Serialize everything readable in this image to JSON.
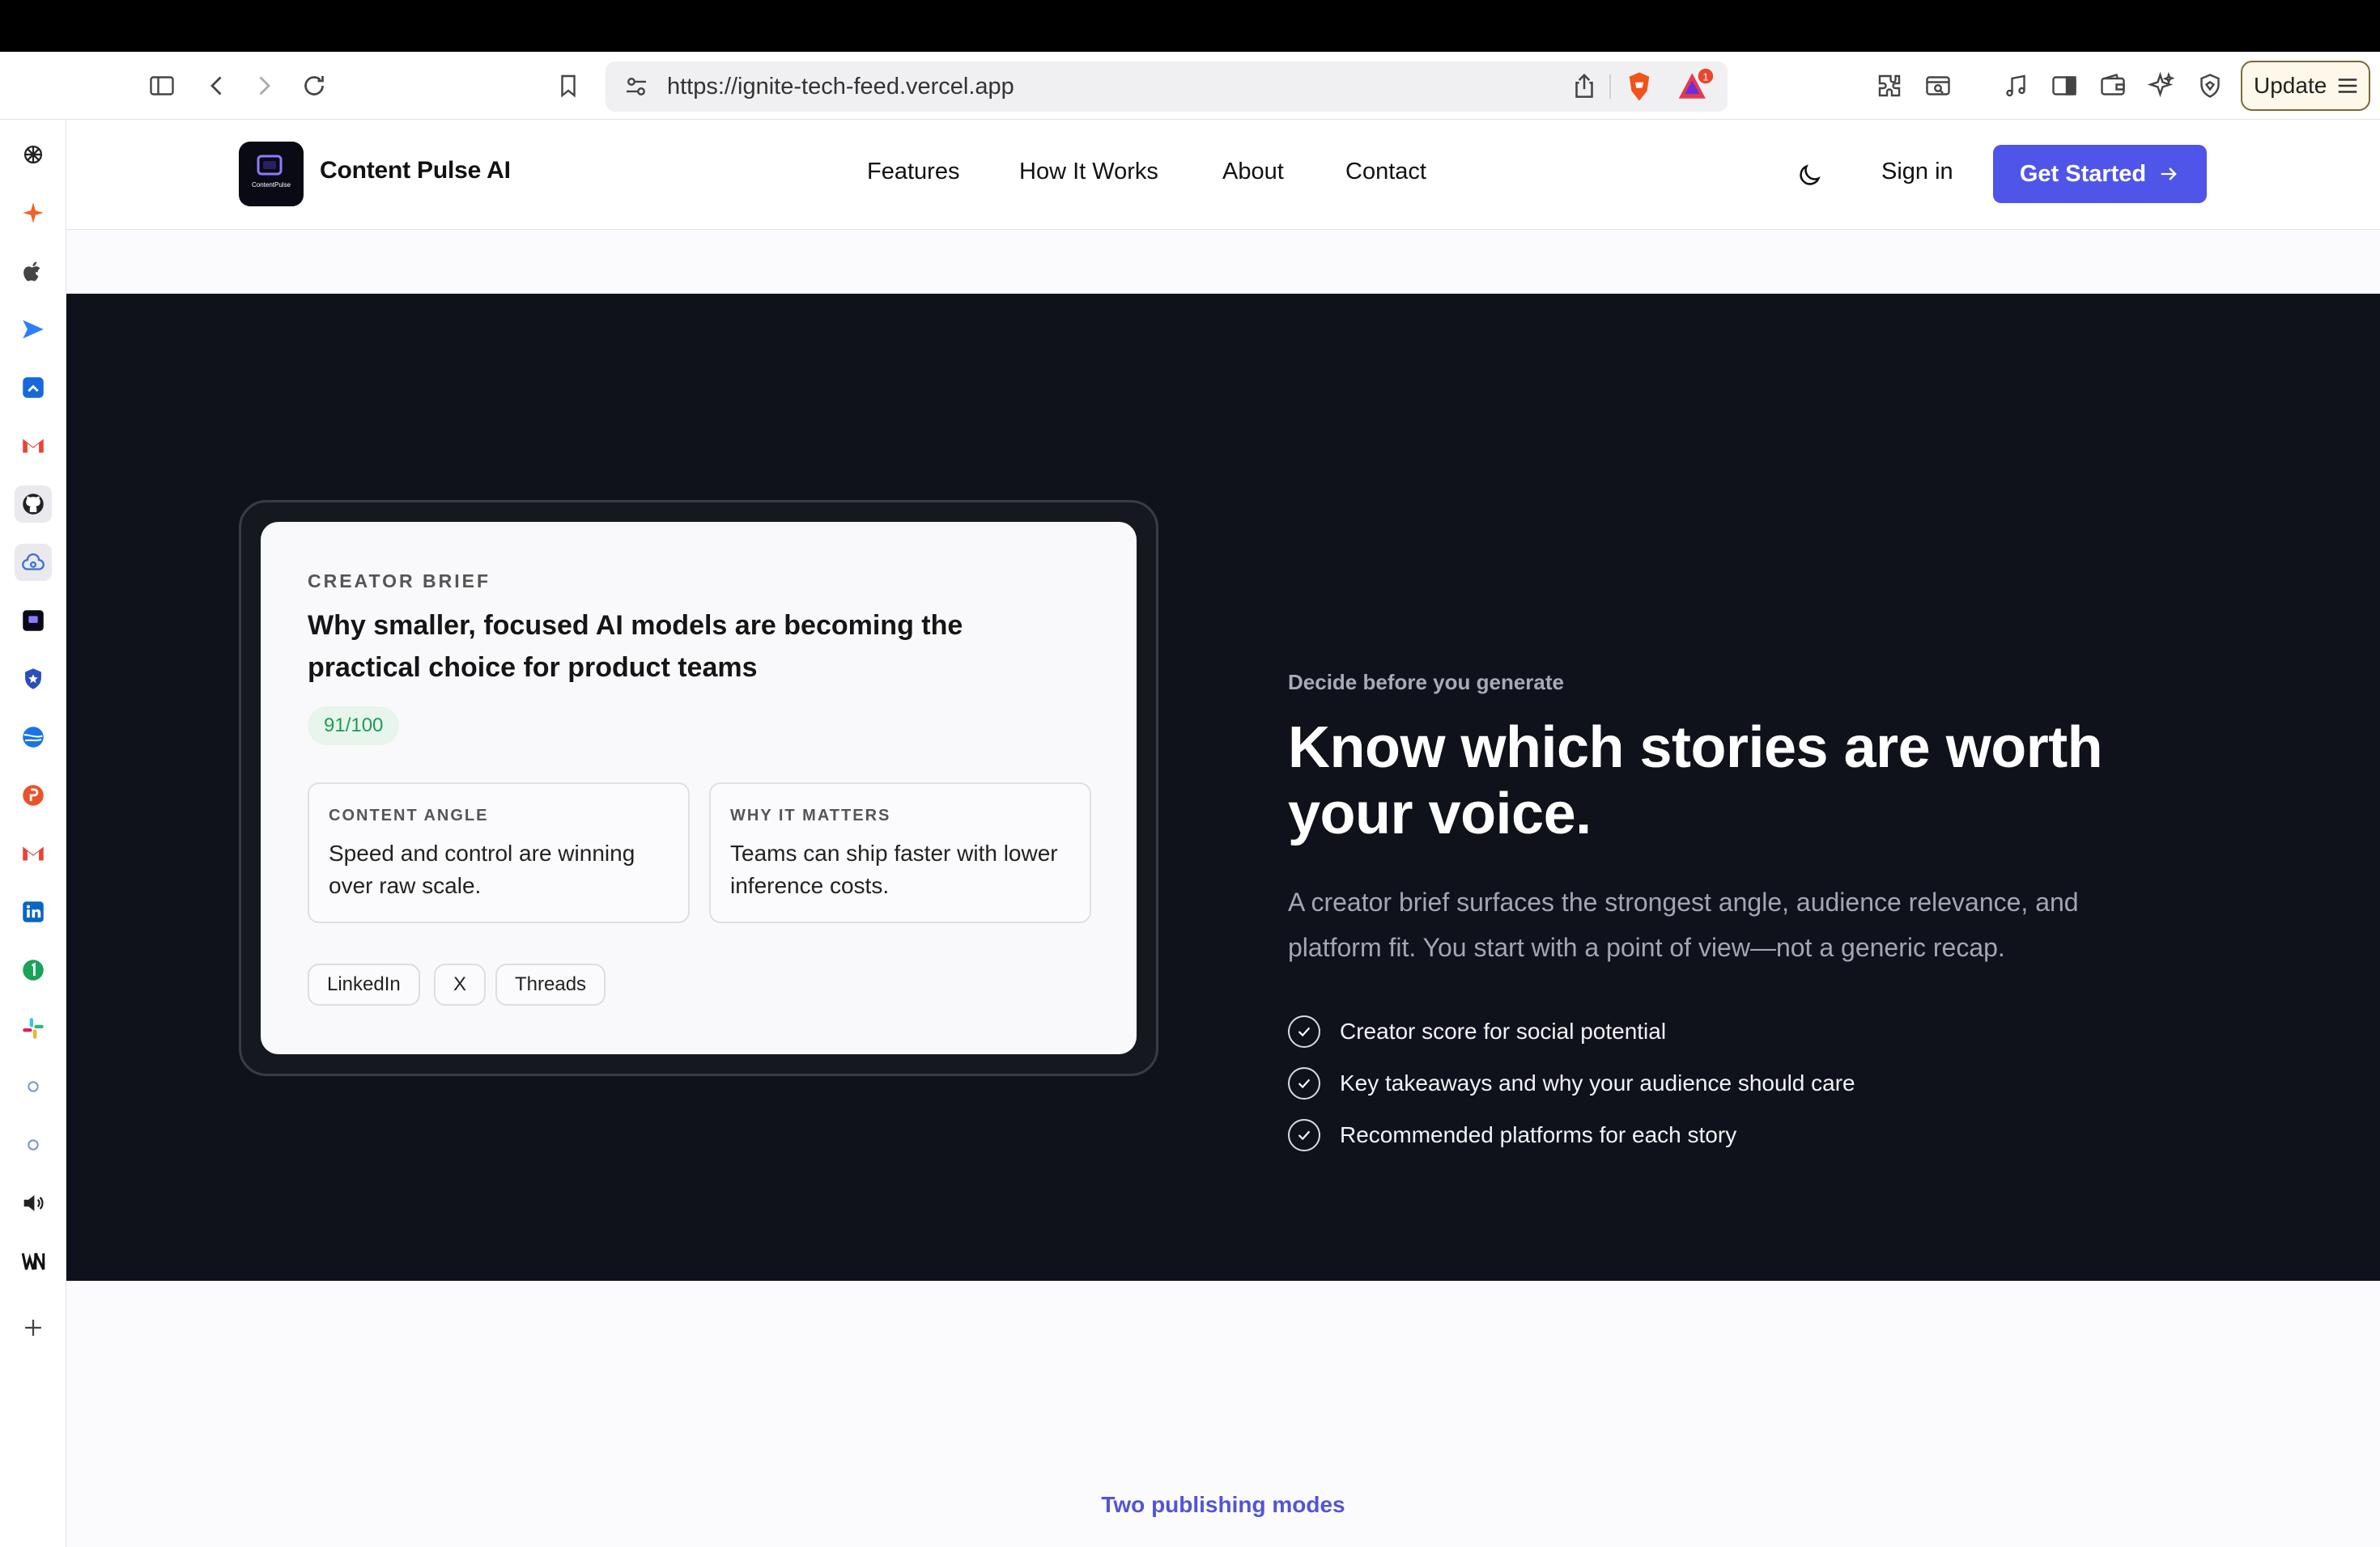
{
  "browser": {
    "url": "https://ignite-tech-feed.vercel.app",
    "update_label": "Update",
    "rewards_badge": "1"
  },
  "nav": {
    "brand": "Content Pulse AI",
    "logo_text": "ContentPulse",
    "links": [
      "Features",
      "How It Works",
      "About",
      "Contact"
    ],
    "signin": "Sign in",
    "cta": "Get Started"
  },
  "brief_card": {
    "eyebrow": "CREATOR BRIEF",
    "headline": "Why smaller, focused AI models are becoming the practical choice for product teams",
    "score": "91/100",
    "angle_label": "CONTENT ANGLE",
    "angle_text": "Speed and control are winning over raw scale.",
    "matters_label": "WHY IT MATTERS",
    "matters_text": "Teams can ship faster with lower inference costs.",
    "platforms": [
      "LinkedIn",
      "X",
      "Threads"
    ]
  },
  "hero": {
    "kicker": "Decide before you generate",
    "title": "Know which stories are worth your voice.",
    "lede": "A creator brief surfaces the strongest angle, audience relevance, and platform fit. You start with a point of view—not a generic recap.",
    "checks": [
      "Creator score for social potential",
      "Key takeaways and why your audience should care",
      "Recommended platforms for each story"
    ]
  },
  "next_section": {
    "kicker": "Two publishing modes"
  },
  "colors": {
    "accent": "#4f55e8",
    "dark_bg": "#0f111b",
    "score_green": "#1f9a55",
    "kicker_purple": "#5155d6"
  }
}
